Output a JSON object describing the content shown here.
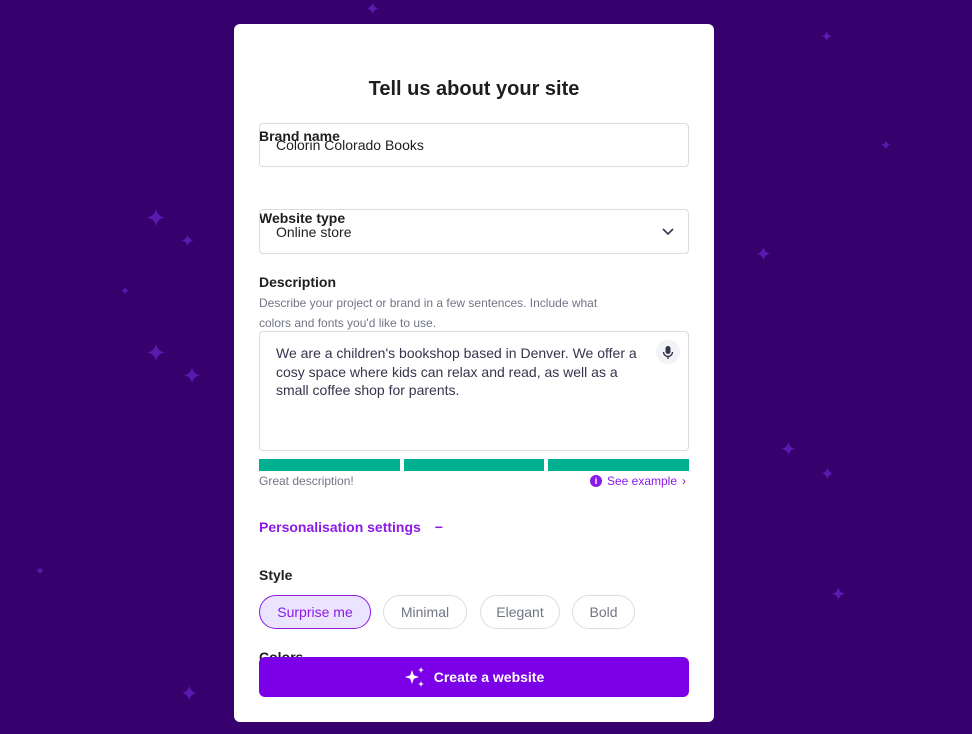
{
  "title": "Tell us about your site",
  "brand": {
    "label": "Brand name",
    "value": "Colorin Colorado Books"
  },
  "type": {
    "label": "Website type",
    "value": "Online store",
    "icon": "chevron-down-icon"
  },
  "description": {
    "label": "Description",
    "help": "Describe your project or brand in a few sentences. Include what colors and fonts you'd like to use.",
    "value": "We are a children's bookshop based in Denver. We offer a cosy space where kids can relax and read, as well as a small coffee shop for parents.",
    "quality_segments_filled": 3,
    "quality_segments_total": 3,
    "feedback": "Great description!",
    "see_example": "See example"
  },
  "personalisation": {
    "label": "Personalisation settings",
    "toggle": "−"
  },
  "style": {
    "label": "Style",
    "options": [
      "Surprise me",
      "Minimal",
      "Elegant",
      "Bold"
    ],
    "selected": "Surprise me"
  },
  "colors_label": "Colors",
  "cta": "Create a website",
  "colors": {
    "accent": "#7b00e8",
    "success": "#00b090",
    "background": "#36006d"
  }
}
